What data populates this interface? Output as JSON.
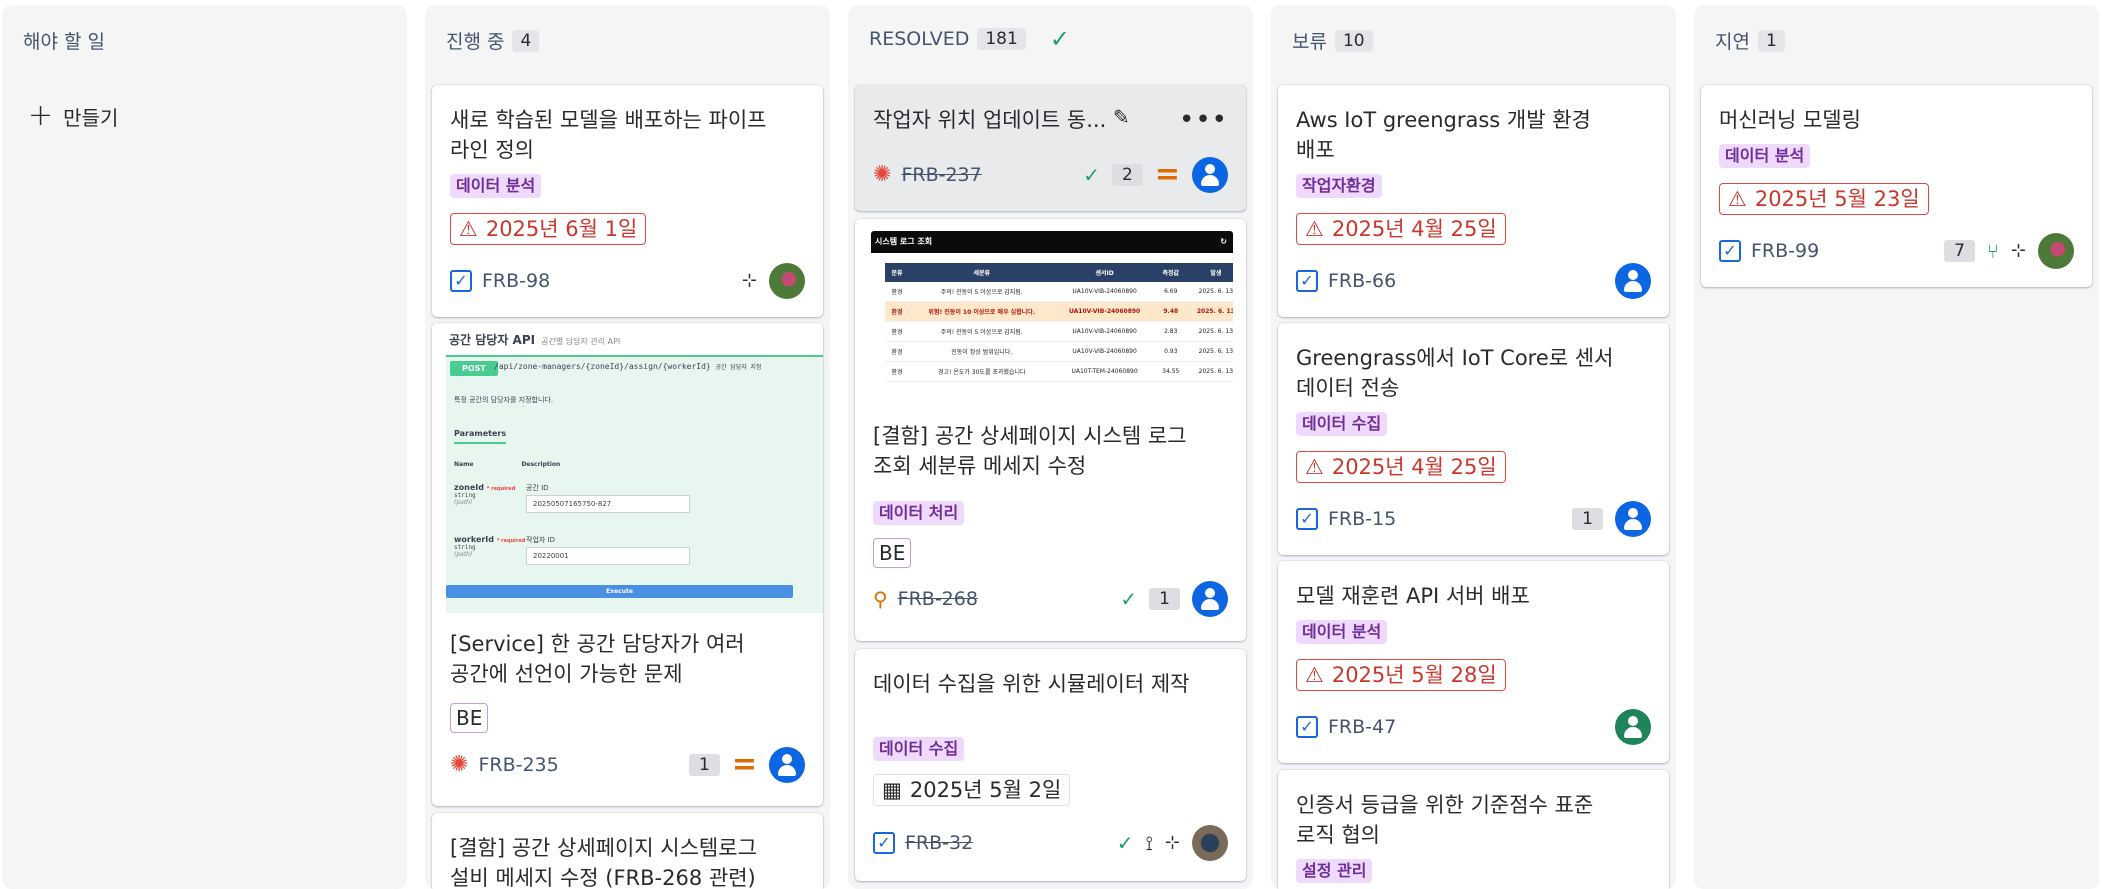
{
  "columns": [
    {
      "title": "해야 할 일",
      "count": "",
      "create_label": "만들기"
    },
    {
      "title": "진행 중",
      "count": "4"
    },
    {
      "title": "RESOLVED",
      "count": "181"
    },
    {
      "title": "보류",
      "count": "10"
    },
    {
      "title": "지연",
      "count": "1"
    }
  ],
  "inprogress": {
    "c1": {
      "title": "새로 학습된 모델을 배포하는 파이프라인 정의",
      "label": "데이터 분석",
      "due": "2025년 6월 1일",
      "key": "FRB-98"
    },
    "c2": {
      "preview": {
        "heading": "공간 담당자 API",
        "sub": "공간별 담당자 관리 API",
        "method": "POST",
        "path": "/api/zone-managers/{zoneId}/assign/{workerId}",
        "path_note": "공간 담당자 지정",
        "desc": "특정 공간의 담당자를 지정합니다.",
        "params": "Parameters",
        "col_name": "Name",
        "col_desc": "Description",
        "f1": "zoneId",
        "f1_label": "공간 ID",
        "f1_value": "20250507165750-827",
        "f2": "workerId",
        "f2_label": "작업자 ID",
        "f2_value": "20220001",
        "req": "* required",
        "type": "string",
        "loc": "(path)",
        "exec": "Execute"
      },
      "title": "[Service] 한 공간 담당자가 여러 공간에 선언이 가능한 문제",
      "tag": "BE",
      "key": "FRB-235",
      "count": "1"
    },
    "c3": {
      "title": "[결함] 공간 상세페이지 시스템로그 설비 메세지 수정 (FRB-268 관련)"
    }
  },
  "resolved": {
    "c1": {
      "title": "작업자 위치 업데이트 동...",
      "key": "FRB-237",
      "count": "2"
    },
    "c2": {
      "preview": {
        "bar": "시스템 로그 조회",
        "refresh": "↻",
        "headers": [
          "분류",
          "세분류",
          "센서ID",
          "측정값",
          "발생"
        ],
        "rows": [
          [
            "환경",
            "주의! 진동이 5 이상으로 감지됨.",
            "UA10V-VIB-24060890",
            "6.69",
            "2025. 6. 13"
          ],
          [
            "환경",
            "위험! 진동이 10 이상으로 매우 심합니다.",
            "UA10V-VIB-24060890",
            "9.48",
            "2025. 6. 13"
          ],
          [
            "환경",
            "주의! 진동이 5 이상으로 감지됨.",
            "UA10V-VIB-24060890",
            "2.83",
            "2025. 6. 13"
          ],
          [
            "환경",
            "진동이 정상 범위입니다.",
            "UA10V-VIB-24060890",
            "0.93",
            "2025. 6. 13"
          ],
          [
            "환경",
            "경고! 온도가 30도를 초과했습니다",
            "UA10T-TEM-24060890",
            "34.55",
            "2025. 6. 13"
          ]
        ]
      },
      "title": "[결함] 공간 상세페이지 시스템 로그 조회 세분류 메세지 수정",
      "label": "데이터 처리",
      "tag": "BE",
      "key": "FRB-268",
      "count": "1"
    },
    "c3": {
      "title": "데이터 수집을 위한 시뮬레이터 제작",
      "label": "데이터 수집",
      "date": "2025년 5월 2일",
      "key": "FRB-32"
    }
  },
  "hold": {
    "c1": {
      "title": "Aws IoT greengrass 개발 환경 배포",
      "label": "작업자환경",
      "due": "2025년 4월 25일",
      "key": "FRB-66"
    },
    "c2": {
      "title": "Greengrass에서 IoT Core로 센서 데이터 전송",
      "label": "데이터 수집",
      "due": "2025년 4월 25일",
      "key": "FRB-15",
      "count": "1"
    },
    "c3": {
      "title": "모델 재훈련 API 서버 배포",
      "label": "데이터 분석",
      "due": "2025년 5월 28일",
      "key": "FRB-47"
    },
    "c4": {
      "title": "인증서 등급을 위한 기준점수 표준 로직 협의",
      "label": "설정 관리"
    }
  },
  "delayed": {
    "c1": {
      "title": "머신러닝 모델링",
      "label": "데이터 분석",
      "due": "2025년 5월 23일",
      "key": "FRB-99",
      "count": "7"
    }
  },
  "icons": {
    "check": "✓",
    "plus": "+",
    "warning": "⚠",
    "prio_medium": "=",
    "more": "•••",
    "edit": "✎",
    "bug": "✺",
    "calendar": "▦",
    "hierarchy": "⊹"
  },
  "colors": {
    "accent_blue": "#0c66e4",
    "danger": "#c9372c",
    "success": "#22a06b",
    "label_bg": "#efd9fd",
    "label_text": "#6e2e97",
    "priority": "#e06c00"
  }
}
